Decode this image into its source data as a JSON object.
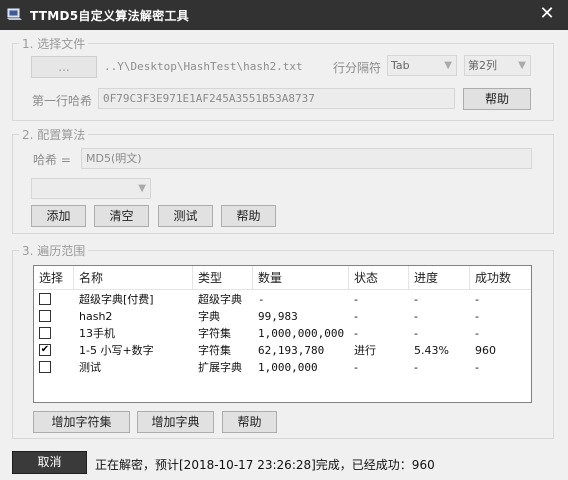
{
  "window": {
    "title": "TTMD5自定义算法解密工具",
    "close_symbol": "✕"
  },
  "group_file": {
    "legend": "1. 选择文件",
    "browse_label": "...",
    "file_path": "..Y\\Desktop\\HashTest\\hash2.txt",
    "separator_label": "行分隔符",
    "separator_value": "Tab",
    "column_value": "第2列",
    "first_hash_label": "第一行哈希",
    "first_hash_value": "0F79C3F3E971E1AF245A3551B53A8737",
    "help_label": "帮助"
  },
  "group_algo": {
    "legend": "2. 配置算法",
    "hash_label": "哈希 =",
    "hash_expr": "MD5(明文)",
    "combo_value": "",
    "add_label": "添加",
    "clear_label": "清空",
    "test_label": "测试",
    "help_label": "帮助"
  },
  "group_range": {
    "legend": "3. 遍历范围",
    "columns": [
      "选择",
      "名称",
      "类型",
      "数量",
      "状态",
      "进度",
      "成功数"
    ],
    "rows": [
      {
        "checked": false,
        "check_mark": "",
        "name": "超级字典[付费]",
        "type": "超级字典",
        "count": "-",
        "state": "-",
        "progress": "-",
        "success": "-"
      },
      {
        "checked": false,
        "check_mark": "",
        "name": "hash2",
        "type": "字典",
        "count": "99,983",
        "state": "-",
        "progress": "-",
        "success": "-"
      },
      {
        "checked": false,
        "check_mark": "",
        "name": "13手机",
        "type": "字符集",
        "count": "1,000,000,000",
        "state": "-",
        "progress": "-",
        "success": "-"
      },
      {
        "checked": true,
        "check_mark": "✔",
        "name": "1-5 小写+数字",
        "type": "字符集",
        "count": "62,193,780",
        "state": "进行",
        "progress": "5.43%",
        "success": "960"
      },
      {
        "checked": false,
        "check_mark": "",
        "name": "测试",
        "type": "扩展字典",
        "count": "1,000,000",
        "state": "-",
        "progress": "-",
        "success": "-"
      }
    ],
    "add_charset_label": "增加字符集",
    "add_dict_label": "增加字典",
    "help_label": "帮助"
  },
  "footer": {
    "cancel_label": "取消",
    "status_text": "正在解密，预计[2018-10-17 23:26:28]完成，已经成功：960"
  }
}
